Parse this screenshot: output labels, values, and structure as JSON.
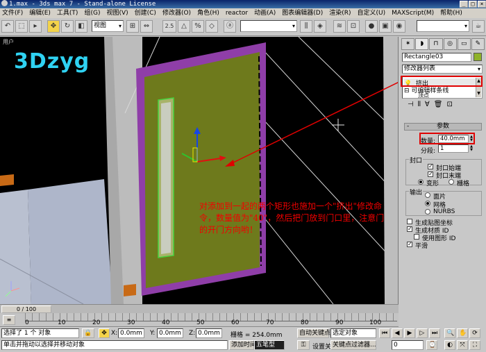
{
  "window": {
    "title": "1.max - 3ds max 7 - Stand-alone License",
    "buttons": [
      "_",
      "□",
      "×"
    ]
  },
  "menu": [
    "文件(F)",
    "编辑(E)",
    "工具(T)",
    "组(G)",
    "视图(V)",
    "创建(C)",
    "修改器(O)",
    "角色(H)",
    "reactor",
    "动画(A)",
    "图表编辑器(D)",
    "渲染(R)",
    "自定义(U)",
    "MAXScript(M)",
    "帮助(H)"
  ],
  "toolbar": {
    "view_select": "视图",
    "snap_label": "2.5",
    "selection_set": ""
  },
  "viewport": {
    "label": "用户",
    "logo": "3Dzyg",
    "annotation": "对添加到一起的两个矩形也施加一个\"挤出\"修改命令，数量值为\"40\"，然后把门放到门口里，注意门的开门方向哟！"
  },
  "timeline": {
    "slider": "0 / 100",
    "ticks": [
      "0",
      "10",
      "20",
      "30",
      "40",
      "50",
      "60",
      "70",
      "80",
      "90",
      "100"
    ]
  },
  "status": {
    "selection": "选择了 1 个 对象",
    "prompt": "单击并拖动以选择并移动对象",
    "x_label": "X:",
    "x_value": "0.0mm",
    "y_label": "Y:",
    "y_value": "0.0mm",
    "z_label": "Z:",
    "z_value": "0.0mm",
    "grid": "栅格 = 254.0mm",
    "add_time_tag": "添加时间",
    "wubi": "五笔型",
    "auto_key": "自动关键点",
    "selected_object": "选定对象",
    "set_key": "设置关键点",
    "key_filter": "关键点过滤器...",
    "frame": "0"
  },
  "command_panel": {
    "object_name": "Rectangle03",
    "object_color": "#8fb22a",
    "modifier_list": "修改器列表",
    "stack": [
      {
        "label": "挤出",
        "icon": "bulb-icon"
      },
      {
        "label": "可编辑样条线",
        "icon": "plus-icon"
      },
      {
        "label": "顶点",
        "icon": ""
      }
    ],
    "rollout_title": "参数",
    "amount_label": "数量:",
    "amount_value": "40.0mm",
    "segments_label": "分段:",
    "segments_value": "1",
    "cap_group": "封口",
    "cap_start": "封口始端",
    "cap_end": "封口末端",
    "morph": "变形",
    "grid": "栅格",
    "output_group": "输出",
    "patch": "面片",
    "mesh": "网格",
    "nurbs": "NURBS",
    "gen_mapping": "生成贴图坐标",
    "gen_mat_ids": "生成材质 ID",
    "use_shape_ids": "使用图形 ID",
    "smooth": "平滑"
  }
}
